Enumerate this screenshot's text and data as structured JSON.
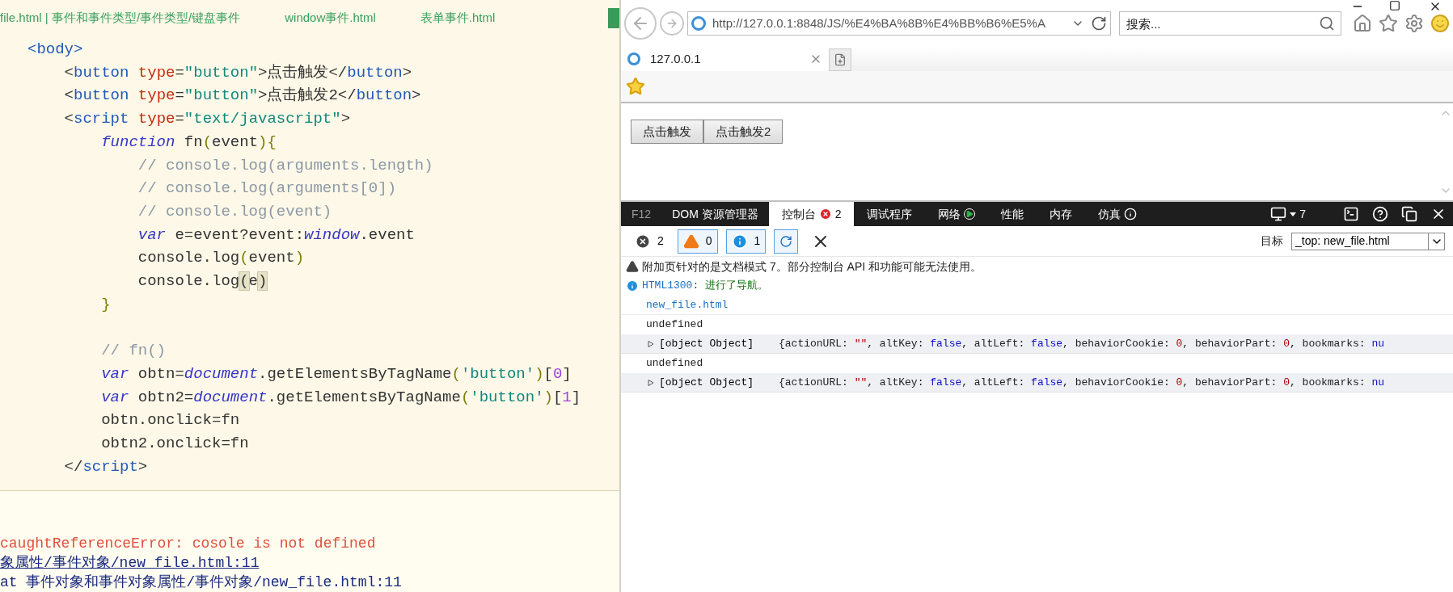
{
  "editor": {
    "tabs": [
      {
        "label": "file.html | 事件和事件类型/事件类型/键盘事件"
      },
      {
        "label": "window事件.html"
      },
      {
        "label": "表单事件.html"
      }
    ],
    "code_lines": [
      {
        "kind": "code",
        "tokens": [
          {
            "kind": "tag",
            "t": "<body>"
          }
        ],
        "children": [
          {
            "kind": "code",
            "tokens": [
              {
                "kind": "p",
                "t": "<"
              },
              {
                "kind": "tag",
                "t": "button"
              },
              {
                "kind": "attr",
                "t": " type"
              },
              {
                "kind": "p",
                "t": "="
              },
              {
                "kind": "str",
                "t": "\"button\""
              },
              {
                "kind": "p",
                "t": ">点击触发</"
              },
              {
                "kind": "tag",
                "t": "button"
              },
              {
                "kind": "p",
                "t": ">"
              }
            ]
          },
          {
            "kind": "code",
            "tokens": [
              {
                "kind": "p",
                "t": "<"
              },
              {
                "kind": "tag",
                "t": "button"
              },
              {
                "kind": "attr",
                "t": " type"
              },
              {
                "kind": "p",
                "t": "="
              },
              {
                "kind": "str",
                "t": "\"button\""
              },
              {
                "kind": "p",
                "t": ">点击触发2</"
              },
              {
                "kind": "tag",
                "t": "button"
              },
              {
                "kind": "p",
                "t": ">"
              }
            ]
          },
          {
            "kind": "code",
            "tokens": [
              {
                "kind": "p",
                "t": "<"
              },
              {
                "kind": "tag",
                "t": "script"
              },
              {
                "kind": "attr",
                "t": " type"
              },
              {
                "kind": "p",
                "t": "="
              },
              {
                "kind": "str",
                "t": "\"text/javascript\""
              },
              {
                "kind": "p",
                "t": ">"
              }
            ],
            "children": [
              {
                "kind": "code",
                "tokens": [
                  {
                    "kind": "kw",
                    "t": "function"
                  },
                  {
                    "kind": "p",
                    "t": " fn"
                  },
                  {
                    "kind": "br",
                    "t": "("
                  },
                  {
                    "kind": "p",
                    "t": "event"
                  },
                  {
                    "kind": "br",
                    "t": "){"
                  }
                ],
                "children": [
                  {
                    "kind": "code",
                    "tokens": [
                      {
                        "kind": "cm",
                        "t": "// console.log(arguments.length)"
                      }
                    ]
                  },
                  {
                    "kind": "code",
                    "tokens": [
                      {
                        "kind": "cm",
                        "t": "// console.log(arguments[0])"
                      }
                    ]
                  },
                  {
                    "kind": "code",
                    "tokens": [
                      {
                        "kind": "cm",
                        "t": "// console.log(event)"
                      }
                    ]
                  },
                  {
                    "kind": "code",
                    "tokens": [
                      {
                        "kind": "kw",
                        "t": "var"
                      },
                      {
                        "kind": "p",
                        "t": " e=event?event:"
                      },
                      {
                        "kind": "kw",
                        "t": "window"
                      },
                      {
                        "kind": "p",
                        "t": ".event"
                      }
                    ]
                  },
                  {
                    "kind": "code",
                    "tokens": [
                      {
                        "kind": "p",
                        "t": "console.log"
                      },
                      {
                        "kind": "br",
                        "t": "("
                      },
                      {
                        "kind": "p",
                        "t": "event"
                      },
                      {
                        "kind": "br",
                        "t": ")"
                      }
                    ]
                  },
                  {
                    "kind": "code",
                    "tokens": [
                      {
                        "kind": "p",
                        "t": "console.log"
                      },
                      {
                        "kind": "hl",
                        "t": "("
                      },
                      {
                        "kind": "p",
                        "t": "e"
                      },
                      {
                        "kind": "hl",
                        "t": ")"
                      }
                    ]
                  }
                ]
              },
              {
                "kind": "code",
                "tokens": [
                  {
                    "kind": "br",
                    "t": "}"
                  }
                ]
              },
              {
                "kind": "blank"
              },
              {
                "kind": "code",
                "tokens": [
                  {
                    "kind": "cm",
                    "t": "// fn()"
                  }
                ]
              },
              {
                "kind": "code",
                "tokens": [
                  {
                    "kind": "kw",
                    "t": "var"
                  },
                  {
                    "kind": "p",
                    "t": " obtn="
                  },
                  {
                    "kind": "kw",
                    "t": "document"
                  },
                  {
                    "kind": "p",
                    "t": ".getElementsByTagName"
                  },
                  {
                    "kind": "br",
                    "t": "("
                  },
                  {
                    "kind": "str",
                    "t": "'button'"
                  },
                  {
                    "kind": "br",
                    "t": ")"
                  },
                  {
                    "kind": "p",
                    "t": "["
                  },
                  {
                    "kind": "num",
                    "t": "0"
                  },
                  {
                    "kind": "p",
                    "t": "]"
                  }
                ]
              },
              {
                "kind": "code",
                "tokens": [
                  {
                    "kind": "kw",
                    "t": "var"
                  },
                  {
                    "kind": "p",
                    "t": " obtn2="
                  },
                  {
                    "kind": "kw",
                    "t": "document"
                  },
                  {
                    "kind": "p",
                    "t": ".getElementsByTagName"
                  },
                  {
                    "kind": "br",
                    "t": "("
                  },
                  {
                    "kind": "str",
                    "t": "'button'"
                  },
                  {
                    "kind": "br",
                    "t": ")"
                  },
                  {
                    "kind": "p",
                    "t": "["
                  },
                  {
                    "kind": "num",
                    "t": "1"
                  },
                  {
                    "kind": "p",
                    "t": "]"
                  }
                ]
              },
              {
                "kind": "code",
                "tokens": [
                  {
                    "kind": "p",
                    "t": "obtn.onclick=fn"
                  }
                ]
              },
              {
                "kind": "code",
                "tokens": [
                  {
                    "kind": "p",
                    "t": "obtn2.onclick=fn"
                  }
                ]
              }
            ]
          },
          {
            "kind": "code",
            "tokens": [
              {
                "kind": "p",
                "t": "</"
              },
              {
                "kind": "tag",
                "t": "script"
              },
              {
                "kind": "p",
                "t": ">"
              }
            ]
          }
        ]
      }
    ],
    "console": [
      {
        "kind": "error",
        "text": "caughtReferenceError: cosole is not defined"
      },
      {
        "kind": "link",
        "text": "象属性/事件对象/new_file.html:11"
      },
      {
        "kind": "trace",
        "text": "at 事件对象和事件对象属性/事件对象/new_file.html:11"
      }
    ]
  },
  "browser": {
    "address": "http://127.0.0.1:8848/JS/%E4%BA%8B%E4%BB%B6%E5%A",
    "search": {
      "placeholder": "搜索..."
    },
    "tabs": [
      {
        "label": "127.0.0.1",
        "selected": true
      }
    ],
    "page_buttons": [
      "点击触发",
      "点击触发2"
    ]
  },
  "devtools": {
    "tabs": [
      {
        "label": "F12",
        "kind": "plain",
        "selected": false
      },
      {
        "label": "DOM 资源管理器",
        "kind": "plain",
        "selected": false
      },
      {
        "label": "控制台",
        "kind": "error",
        "badge": "2",
        "selected": true
      },
      {
        "label": "调试程序",
        "kind": "plain",
        "selected": false
      },
      {
        "label": "网络",
        "kind": "play",
        "selected": false
      },
      {
        "label": "性能",
        "kind": "plain",
        "selected": false
      },
      {
        "label": "内存",
        "kind": "plain",
        "selected": false
      },
      {
        "label": "仿真",
        "kind": "info",
        "selected": false
      }
    ],
    "emulation_count": "7",
    "filters": [
      {
        "kind": "error",
        "count": "2",
        "selected": false
      },
      {
        "kind": "warning",
        "count": "0",
        "selected": true
      },
      {
        "kind": "info",
        "count": "1",
        "selected": true
      }
    ],
    "target": {
      "label": "目标",
      "value": "_top: new_file.html"
    },
    "messages": [
      {
        "kind": "warning",
        "text": "附加页针对的是文档模式 7。部分控制台 API 和功能可能无法使用。"
      },
      {
        "kind": "info",
        "code": "HTML1300",
        "text": ": 进行了导航。"
      },
      {
        "kind": "link",
        "text": "new_file.html"
      },
      {
        "kind": "plain",
        "text": "undefined"
      },
      {
        "kind": "object",
        "text": "[object Object]",
        "expanded": false,
        "tokens": [
          {
            "kind": "p",
            "t": "{actionURL: "
          },
          {
            "kind": "str",
            "t": "\"\""
          },
          {
            "kind": "p",
            "t": ", altKey: "
          },
          {
            "kind": "bool",
            "t": "false"
          },
          {
            "kind": "p",
            "t": ", altLeft: "
          },
          {
            "kind": "bool",
            "t": "false"
          },
          {
            "kind": "p",
            "t": ", behaviorCookie: "
          },
          {
            "kind": "num",
            "t": "0"
          },
          {
            "kind": "p",
            "t": ", behaviorPart: "
          },
          {
            "kind": "num",
            "t": "0"
          },
          {
            "kind": "p",
            "t": ", bookmarks: "
          },
          {
            "kind": "bool",
            "t": "nu"
          }
        ]
      },
      {
        "kind": "plain",
        "text": "undefined"
      },
      {
        "kind": "object",
        "text": "[object Object]",
        "expanded": false,
        "tokens": [
          {
            "kind": "p",
            "t": "{actionURL: "
          },
          {
            "kind": "str",
            "t": "\"\""
          },
          {
            "kind": "p",
            "t": ", altKey: "
          },
          {
            "kind": "bool",
            "t": "false"
          },
          {
            "kind": "p",
            "t": ", altLeft: "
          },
          {
            "kind": "bool",
            "t": "false"
          },
          {
            "kind": "p",
            "t": ", behaviorCookie: "
          },
          {
            "kind": "num",
            "t": "0"
          },
          {
            "kind": "p",
            "t": ", behaviorPart: "
          },
          {
            "kind": "num",
            "t": "0"
          },
          {
            "kind": "p",
            "t": ", bookmarks: "
          },
          {
            "kind": "bool",
            "t": "nu"
          }
        ]
      }
    ]
  }
}
